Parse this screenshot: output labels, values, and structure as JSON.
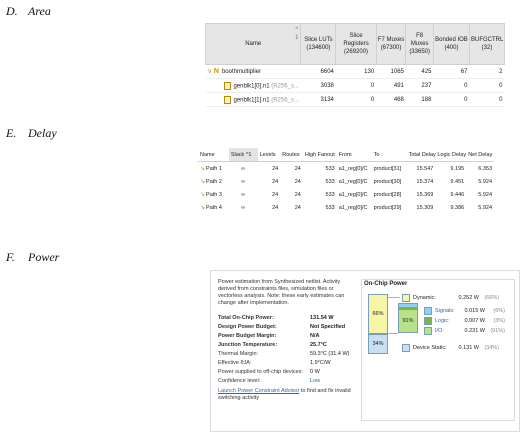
{
  "sections": {
    "area": {
      "letter": "D.",
      "title": "Area"
    },
    "delay": {
      "letter": "E.",
      "title": "Delay"
    },
    "power": {
      "letter": "F.",
      "title": "Power"
    }
  },
  "area_table": {
    "headers": [
      "Name",
      "Slice LUTs (134600)",
      "Slice Registers (269200)",
      "F7 Muxes (67300)",
      "F8 Muxes (33650)",
      "Bonded IOB (400)",
      "BUFGCTRL (32)"
    ],
    "sort_mark": "^",
    "sort_index": "1",
    "rows": [
      {
        "caret": "∨",
        "icon": "N",
        "name": "boothmultiplier",
        "suffix": "",
        "values": [
          "6604",
          "130",
          "1065",
          "425",
          "67",
          "2"
        ]
      },
      {
        "caret": "",
        "icon": "file",
        "name": "genblk1[0].n1",
        "suffix": "(R256_s...",
        "values": [
          "3038",
          "0",
          "491",
          "237",
          "0",
          "0"
        ]
      },
      {
        "caret": "",
        "icon": "file",
        "name": "genblk1[1].n1",
        "suffix": "(R256_s...",
        "values": [
          "3134",
          "0",
          "468",
          "188",
          "0",
          "0"
        ]
      }
    ]
  },
  "delay_table": {
    "headers": [
      "Name",
      "Slack",
      "Levels",
      "Routes",
      "High Fanout",
      "From",
      "To",
      "Total Delay",
      "Logic Delay",
      "Net Delay"
    ],
    "slack_sort": "^1",
    "rows": [
      {
        "name": "Path 1",
        "slack": "∞",
        "levels": "24",
        "routes": "24",
        "fanout": "533",
        "from": "a1_reg[0]/C",
        "to": "product[31]",
        "total": "15.547",
        "logic": "9.195",
        "net": "6.353"
      },
      {
        "name": "Path 2",
        "slack": "∞",
        "levels": "24",
        "routes": "24",
        "fanout": "533",
        "from": "a1_reg[0]/C",
        "to": "product[30]",
        "total": "15.374",
        "logic": "9.451",
        "net": "5.924"
      },
      {
        "name": "Path 3",
        "slack": "∞",
        "levels": "24",
        "routes": "24",
        "fanout": "533",
        "from": "a1_reg[0]/C",
        "to": "product[28]",
        "total": "15.369",
        "logic": "9.446",
        "net": "5.924"
      },
      {
        "name": "Path 4",
        "slack": "∞",
        "levels": "24",
        "routes": "24",
        "fanout": "533",
        "from": "a1_reg[0]/C",
        "to": "product[29]",
        "total": "15.309",
        "logic": "9.386",
        "net": "5.924"
      }
    ]
  },
  "power": {
    "description": "Power estimation from Synthesized netlist. Activity derived from constraints files, simulation files or vectorless analysis. Note: these early estimates can change after implementation.",
    "summary": [
      {
        "label": "Total On-Chip Power:",
        "value": "131.54 W",
        "bold": true
      },
      {
        "label": "Design Power Budget:",
        "value": "Not Specified",
        "bold": true
      },
      {
        "label": "Power Budget Margin:",
        "value": "N/A",
        "bold": true
      },
      {
        "label": "Junction Temperature:",
        "value": "25.7°C",
        "bold": true
      },
      {
        "label": "Thermal Margin:",
        "value": "59.3°C (31.4 W)",
        "bold": false
      },
      {
        "label": "Effective ϑJA:",
        "value": "1.9°C/W",
        "bold": false
      },
      {
        "label": "Power supplied to off-chip devices:",
        "value": "0 W",
        "bold": false
      },
      {
        "label": "Confidence level:",
        "value": "Low",
        "bold": false,
        "link": true
      }
    ],
    "link_text": "Launch Power Constraint Advisor",
    "link_suffix": " to find and fix invalid switching activity",
    "onchip": {
      "title": "On-Chip Power",
      "dynamic": {
        "label": "Dynamic:",
        "value": "0.252 W",
        "pct": "(66%)",
        "bar_pct": "66%",
        "color": "#f6f5a8"
      },
      "static": {
        "label": "Device Static:",
        "value": "0.131 W",
        "pct": "(34%)",
        "bar_pct": "34%",
        "color": "#c8dff5"
      },
      "breakdown": [
        {
          "label": "Signals:",
          "value": "0.015 W",
          "pct": "(6%)",
          "color": "#8fd3f0"
        },
        {
          "label": "Logic:",
          "value": "0.007 W",
          "pct": "(3%)",
          "color": "#7ab648"
        },
        {
          "label": "I/O:",
          "value": "0.231 W",
          "pct": "(91%)",
          "color": "#b8e28a"
        }
      ],
      "io_bar_pct": "91%"
    }
  }
}
